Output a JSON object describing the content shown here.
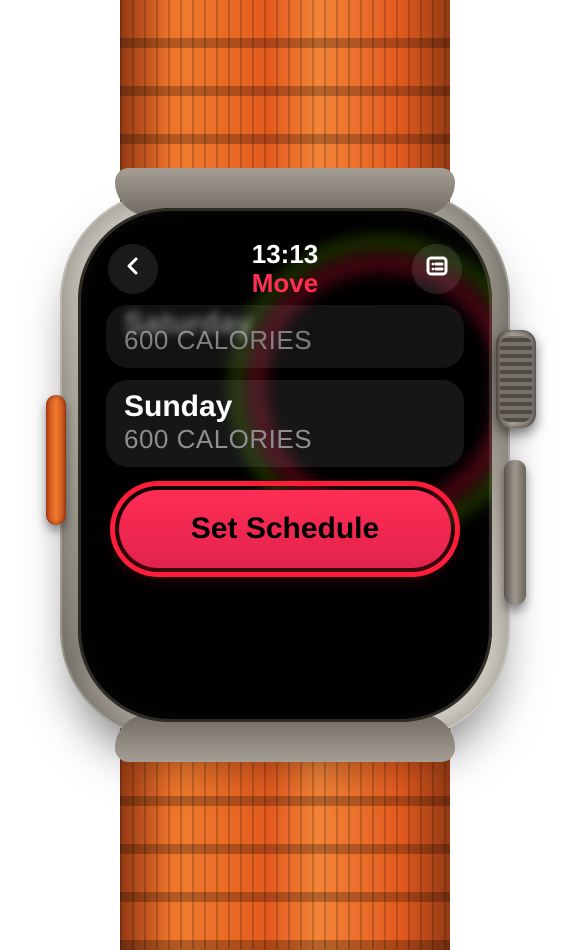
{
  "colors": {
    "accent": "#ff2f53",
    "title": "#ff2f53"
  },
  "status": {
    "time": "13:13",
    "title": "Move"
  },
  "items": [
    {
      "day": "Saturday",
      "calories": "600 CALORIES"
    },
    {
      "day": "Sunday",
      "calories": "600 CALORIES"
    }
  ],
  "cta": {
    "label": "Set Schedule"
  },
  "icons": {
    "back": "chevron-left",
    "menu": "list"
  }
}
